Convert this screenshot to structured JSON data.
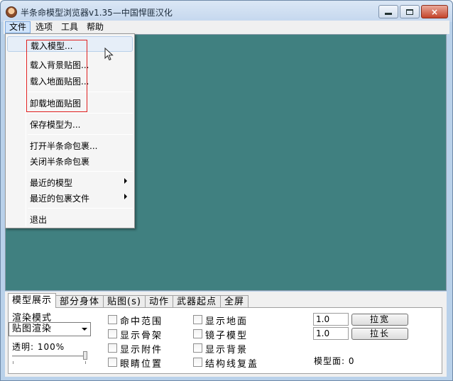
{
  "window": {
    "title": "半条命模型浏览器v1.35—中国悍匪汉化",
    "controls": {
      "minimize": "minimize-icon",
      "maximize": "maximize-icon",
      "close": "×"
    }
  },
  "menubar": [
    "文件",
    "选项",
    "工具",
    "帮助"
  ],
  "file_menu": {
    "items": [
      {
        "label": "载入模型..."
      },
      {
        "label": "载入背景贴图..."
      },
      {
        "label": "载入地面贴图..."
      },
      {
        "label": "卸载地面贴图"
      },
      {
        "label": "保存模型为..."
      },
      {
        "label": "打开半条命包裹..."
      },
      {
        "label": "关闭半条命包裹"
      },
      {
        "label": "最近的模型",
        "submenu": true
      },
      {
        "label": "最近的包裹文件",
        "submenu": true
      },
      {
        "label": "退出"
      }
    ],
    "highlight_color": "#e02020"
  },
  "viewport": {
    "background": "#408080"
  },
  "tabs": [
    "模型展示",
    "部分身体",
    "贴图(s)",
    "动作",
    "武器起点",
    "全屏"
  ],
  "panel": {
    "render_mode_label": "渲染模式",
    "render_mode_value": "贴图渲染",
    "opacity_label": "透明: 100%",
    "opacity_value": 1.0,
    "checkboxes_col1": [
      "命中范围",
      "显示骨架",
      "显示附件",
      "眼睛位置"
    ],
    "checkboxes_col2": [
      "显示地面",
      "镜子模型",
      "显示背景",
      "结构线复盖"
    ],
    "scale_input_1": "1.0",
    "scale_input_2": "1.0",
    "stretch_wide_button": "拉宽",
    "stretch_long_button": "拉长",
    "faces_label": "模型面: 0"
  }
}
